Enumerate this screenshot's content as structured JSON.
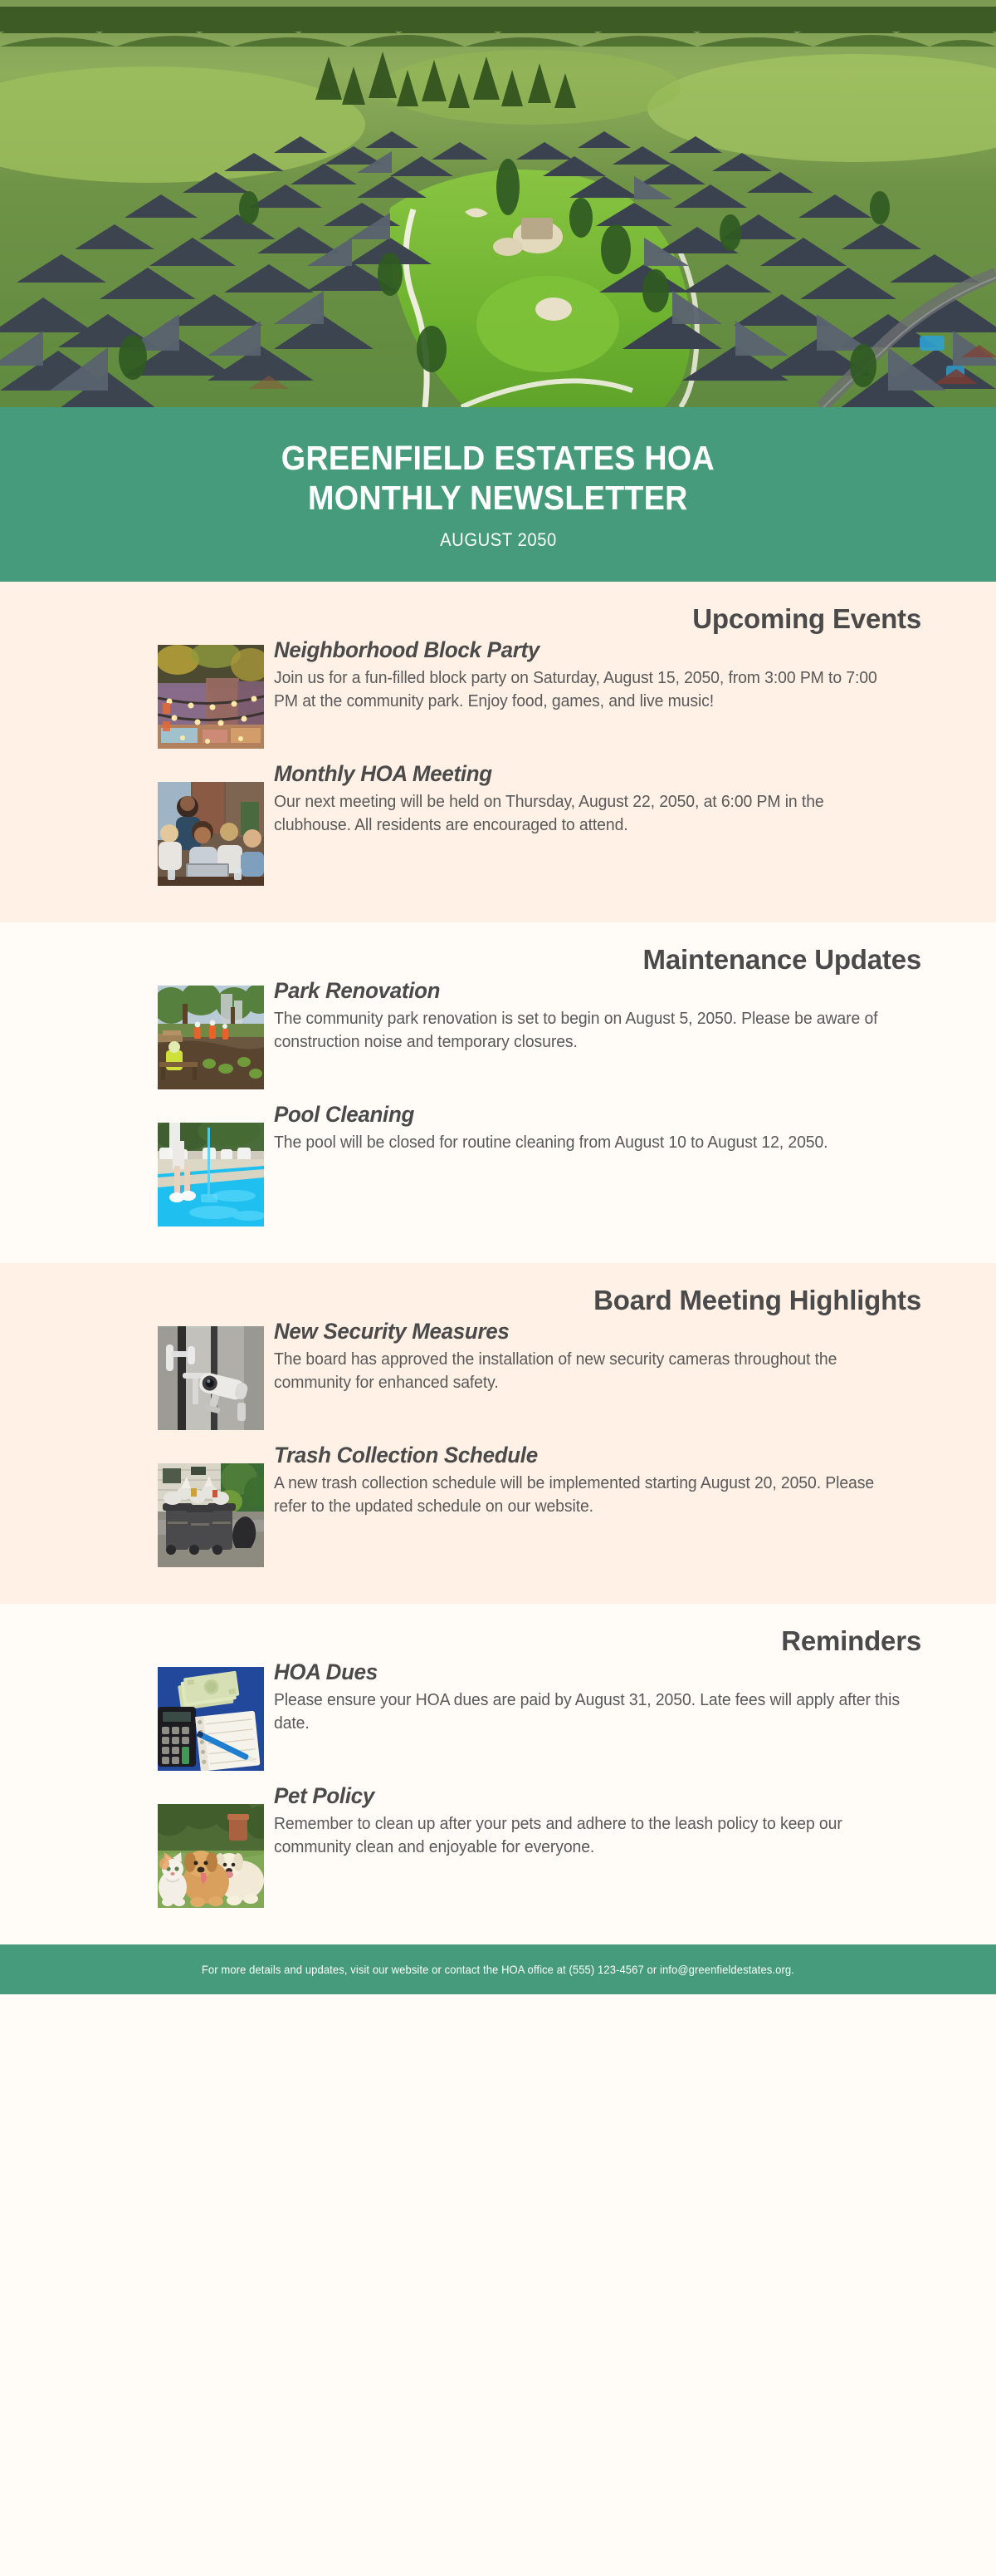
{
  "hero": {
    "alt": "aerial-view-suburban-golf-course-community"
  },
  "header": {
    "title_line1": "GREENFIELD ESTATES HOA",
    "title_line2": "MONTHLY NEWSLETTER",
    "issue_date": "AUGUST 2050",
    "banner_color": "#459B7C"
  },
  "sections": [
    {
      "heading": "Upcoming Events",
      "background": "#FFF1E6",
      "items": [
        {
          "title": "Neighborhood Block Party",
          "text": "Join us for a fun-filled block party on Saturday, August 15, 2050, from 3:00 PM to 7:00 PM at the community park. Enjoy food, games, and live music!",
          "image": "street-festival-lights-thumbnail"
        },
        {
          "title": "Monthly HOA Meeting",
          "text": "Our next meeting will be held on Thursday, August 22, 2050, at 6:00 PM in the clubhouse. All residents are encouraged to attend.",
          "image": "group-meeting-laptop-thumbnail"
        }
      ]
    },
    {
      "heading": "Maintenance Updates",
      "background": "#FFFCF8",
      "items": [
        {
          "title": "Park Renovation",
          "text": "The community park renovation is set to begin on August 5, 2050. Please be aware of construction noise and temporary closures.",
          "image": "park-construction-workers-thumbnail"
        },
        {
          "title": "Pool Cleaning",
          "text": "The pool will be closed for routine cleaning from August 10 to August 12, 2050.",
          "image": "swimming-pool-cleaning-thumbnail"
        }
      ]
    },
    {
      "heading": "Board Meeting Highlights",
      "background": "#FFF1E6",
      "items": [
        {
          "title": "New Security Measures",
          "text": "The board has approved the installation of new security cameras throughout the community for enhanced safety.",
          "image": "security-camera-thumbnail"
        },
        {
          "title": "Trash Collection Schedule",
          "text": "A new trash collection schedule will be implemented starting August 20, 2050. Please refer to the updated schedule on our website.",
          "image": "trash-bins-curbside-thumbnail"
        }
      ]
    },
    {
      "heading": "Reminders",
      "background": "#FFFCF8",
      "items": [
        {
          "title": "HOA Dues",
          "text": "Please ensure your HOA dues are paid by August 31, 2050. Late fees will apply after this date.",
          "image": "calculator-money-notebook-thumbnail"
        },
        {
          "title": "Pet Policy",
          "text": "Remember to clean up after your pets and adhere to the leash policy to keep our community clean and enjoyable for everyone.",
          "image": "cat-and-dogs-thumbnail"
        }
      ]
    }
  ],
  "footer": {
    "text": "For more details and updates, visit our website or contact the HOA office at (555) 123-4567 or info@greenfieldestates.org.",
    "background": "#459B7C"
  }
}
